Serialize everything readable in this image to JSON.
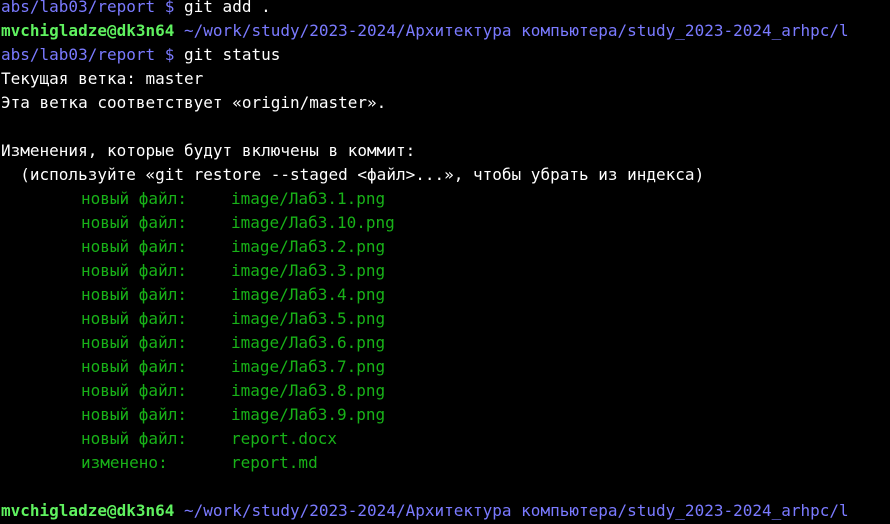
{
  "terminal": {
    "colors": {
      "background": "#000000",
      "text": "#ffffff",
      "user": "#5ff15f",
      "path": "#7a7aff",
      "staged": "#18b218"
    },
    "line1": {
      "path": "abs/lab03/report $",
      "cmd": " git add ."
    },
    "line2": {
      "user": "mvchigladze@dk3n64",
      "path": " ~/work/study/2023-2024/Архитектура компьютера/study_2023-2024_arhpc/l"
    },
    "line3": {
      "path": "abs/lab03/report $",
      "cmd": " git status"
    },
    "output": {
      "branch": "Текущая ветка: master",
      "tracking": "Эта ветка соответствует «origin/master».",
      "changes_header": "Изменения, которые будут включены в коммит:",
      "hint": "  (используйте «git restore --staged <файл>...», чтобы убрать из индекса)"
    },
    "staged": [
      {
        "status": "новый файл:",
        "file": "image/Лаб3.1.png"
      },
      {
        "status": "новый файл:",
        "file": "image/Лаб3.10.png"
      },
      {
        "status": "новый файл:",
        "file": "image/Лаб3.2.png"
      },
      {
        "status": "новый файл:",
        "file": "image/Лаб3.3.png"
      },
      {
        "status": "новый файл:",
        "file": "image/Лаб3.4.png"
      },
      {
        "status": "новый файл:",
        "file": "image/Лаб3.5.png"
      },
      {
        "status": "новый файл:",
        "file": "image/Лаб3.6.png"
      },
      {
        "status": "новый файл:",
        "file": "image/Лаб3.7.png"
      },
      {
        "status": "новый файл:",
        "file": "image/Лаб3.8.png"
      },
      {
        "status": "новый файл:",
        "file": "image/Лаб3.9.png"
      },
      {
        "status": "новый файл:",
        "file": "report.docx"
      },
      {
        "status": "изменено:",
        "file": "report.md"
      }
    ],
    "last_prompt": {
      "user": "mvchigladze@dk3n64",
      "path": " ~/work/study/2023-2024/Архитектура компьютера/study_2023-2024_arhpc/l"
    }
  }
}
